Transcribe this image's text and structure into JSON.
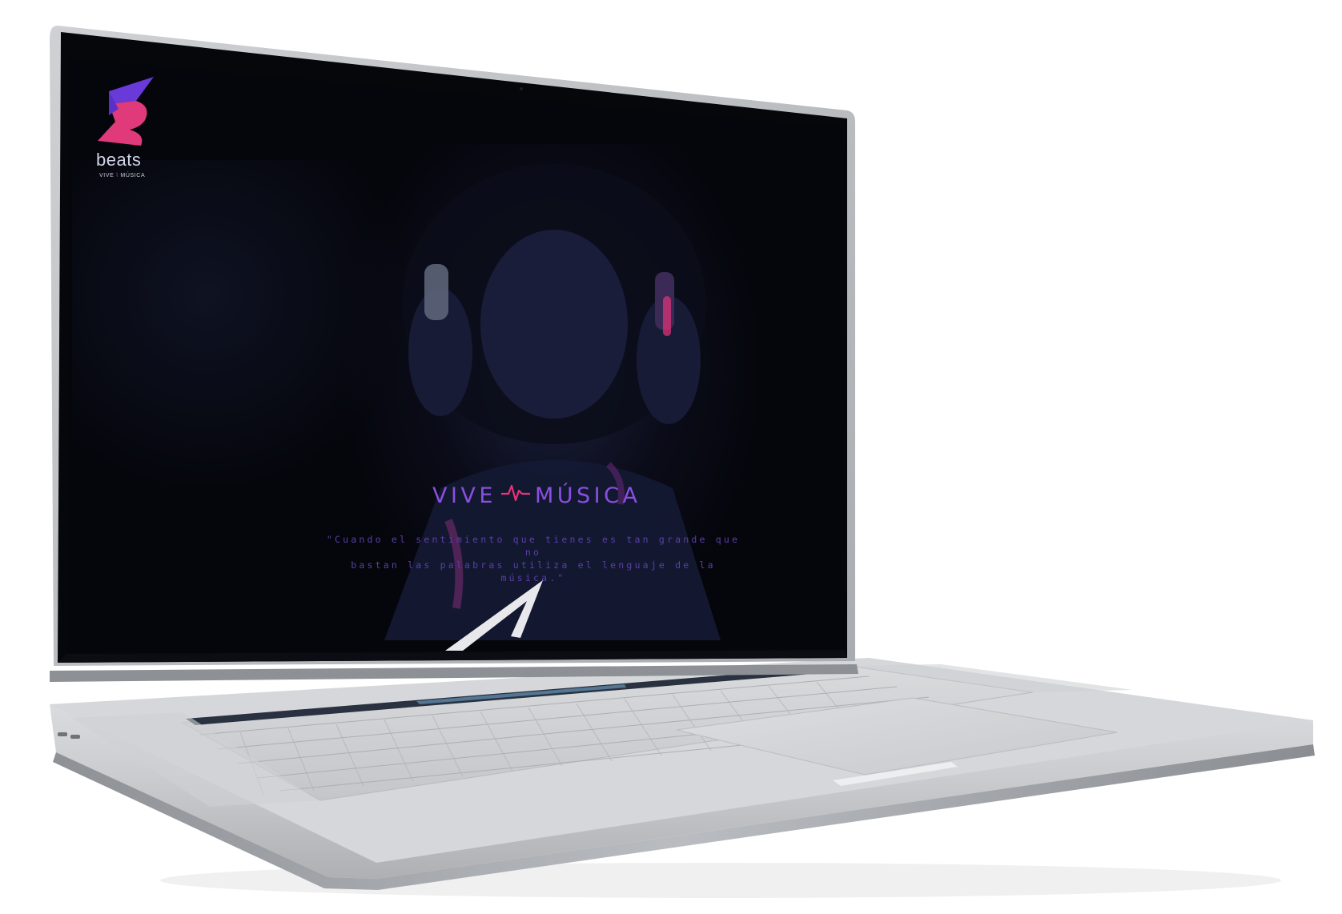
{
  "logo": {
    "icon": "beats-lightning-b-logo",
    "wordmark": "beats",
    "tagline_left": "VIVE",
    "tagline_right": "MÚSICA"
  },
  "hero": {
    "headline_left": "VIVE",
    "headline_right": "MÚSICA",
    "quote_line_1": "\"Cuando el sentimiento que tienes es tan grande que no",
    "quote_line_2": "bastan las palabras utiliza el lenguaje de la música.\""
  },
  "scroll_indicator": {
    "icon": "chevron-up-icon"
  },
  "colors": {
    "accent_purple": "#8a4fe0",
    "accent_pink": "#e6337a",
    "logo_violet": "#7b3fe4",
    "screen_bg": "#05060c",
    "laptop_silver": "#d2d4d7"
  }
}
